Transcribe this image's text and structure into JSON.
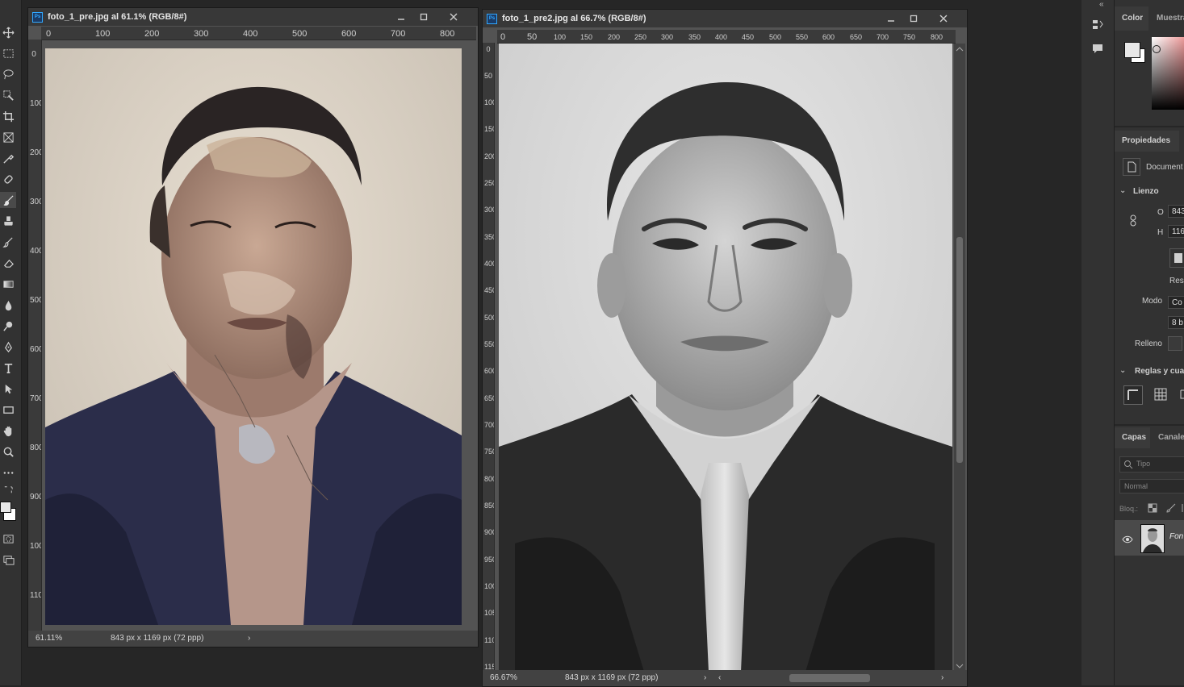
{
  "window_left": {
    "title": "foto_1_pre.jpg al 61.1% (RGB/8#)",
    "ruler_h": [
      "0",
      "100",
      "200",
      "300",
      "400",
      "500",
      "600",
      "700",
      "800"
    ],
    "ruler_v": [
      "0",
      "100",
      "200",
      "300",
      "400",
      "500",
      "600",
      "700",
      "800",
      "900",
      "1000",
      "1100"
    ],
    "zoom": "61.11%",
    "doc_info": "843 px x 1169 px (72 ppp)"
  },
  "window_right": {
    "title": "foto_1_pre2.jpg al 66.7% (RGB/8#)",
    "ruler_h": [
      "0",
      "50",
      "100",
      "150",
      "200",
      "250",
      "300",
      "350",
      "400",
      "450",
      "500",
      "550",
      "600",
      "650",
      "700",
      "750",
      "800"
    ],
    "ruler_v": [
      "0",
      "50",
      "100",
      "150",
      "200",
      "250",
      "300",
      "350",
      "400",
      "450",
      "500",
      "550",
      "600",
      "650",
      "700",
      "750",
      "800",
      "850",
      "900",
      "950",
      "1000",
      "1050",
      "1100",
      "1150"
    ],
    "zoom": "66.67%",
    "doc_info": "843 px x 1169 px (72 ppp)"
  },
  "panels": {
    "color_tab": "Color",
    "swatches_tab": "Muestra",
    "properties_title": "Propiedades",
    "document_label": "Document",
    "canvas_section": "Lienzo",
    "width_label": "O",
    "width_value": "843",
    "height_label": "H",
    "height_value": "116",
    "resolution_label": "Res",
    "mode_label": "Modo",
    "mode_value": "Co",
    "depth_value": "8 b",
    "fill_label": "Relleno",
    "rulers_section": "Reglas y cua",
    "layers_tab": "Capas",
    "channels_tab": "Canale",
    "layer_search_placeholder": "Tipo",
    "blend_mode": "Normal",
    "lock_label": "Bloq.:",
    "layer_name": "Fon"
  },
  "colors": {
    "app_bg": "#262626",
    "panel_bg": "#323232",
    "accent": "#31a8ff"
  }
}
